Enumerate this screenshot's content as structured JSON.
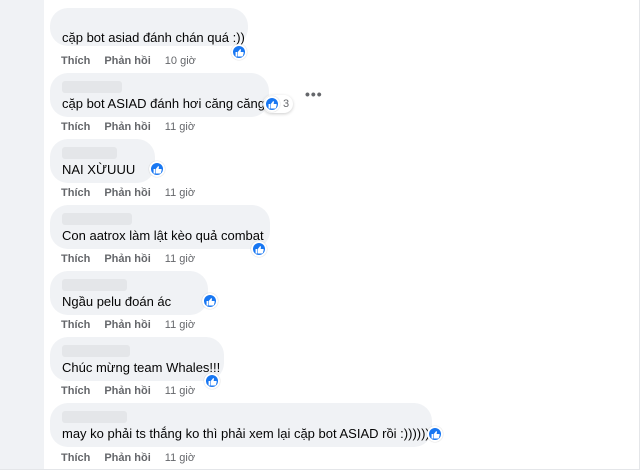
{
  "comments": [
    {
      "text": "cặp bot asiad đánh chán quá :))",
      "like": "Thích",
      "reply": "Phản hồi",
      "time": "10 giờ",
      "reaction_count": ""
    },
    {
      "text": "cặp bot ASIAD đánh hơi căng căng",
      "like": "Thích",
      "reply": "Phản hồi",
      "time": "11 giờ",
      "reaction_count": "3"
    },
    {
      "text": "NAI XỪUUU",
      "like": "Thích",
      "reply": "Phản hồi",
      "time": "11 giờ",
      "reaction_count": ""
    },
    {
      "text": "Con aatrox làm lật kèo quả combat",
      "like": "Thích",
      "reply": "Phản hồi",
      "time": "11 giờ",
      "reaction_count": ""
    },
    {
      "text": "Ngầu pelu đoán ác",
      "like": "Thích",
      "reply": "Phản hồi",
      "time": "11 giờ",
      "reaction_count": ""
    },
    {
      "text": "Chúc mừng team Whales!!!",
      "like": "Thích",
      "reply": "Phản hồi",
      "time": "11 giờ",
      "reaction_count": ""
    },
    {
      "text": "may ko phải ts thắng ko thì phải xem lại cặp bot ASIAD rồi :))))))",
      "like": "Thích",
      "reply": "Phản hồi",
      "time": "11 giờ",
      "reaction_count": ""
    }
  ],
  "more_icon": "•••",
  "icons": {
    "reaction": "like-thumb-icon",
    "menu": "more-options-icon"
  },
  "colors": {
    "bubble": "#f0f2f5",
    "like_blue": "#1877f2",
    "meta_text": "#65676b"
  }
}
